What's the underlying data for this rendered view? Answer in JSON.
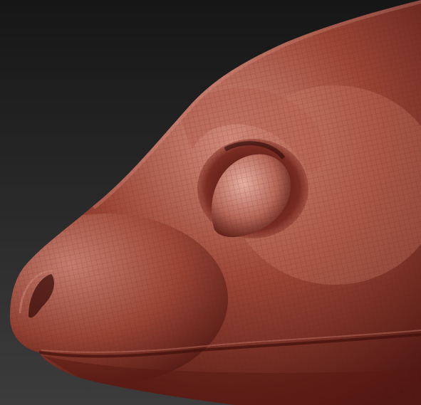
{
  "scene": {
    "subject": "sculpted-creature-head-render",
    "colors": {
      "background_top": "#161616",
      "background_bottom": "#3c3c3c",
      "material_base": "#9c4636",
      "material_highlight": "#d08a7a",
      "material_shadow": "#4a1410",
      "wireframe": "#5a2018"
    }
  }
}
